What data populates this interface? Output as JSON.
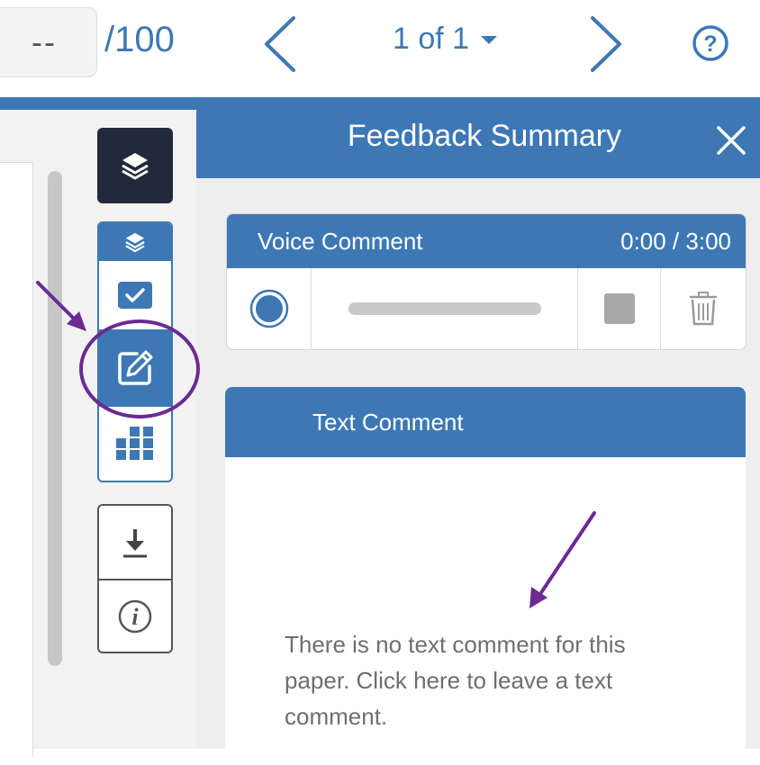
{
  "topbar": {
    "score_value": "--",
    "score_max": "/100",
    "page_indicator": "1 of 1",
    "icons": {
      "prev": "chevron-left-icon",
      "next": "chevron-right-icon",
      "dropdown": "caret-down-icon",
      "help": "question-circle-icon"
    }
  },
  "tool_rail": {
    "items": [
      "layers-icon",
      "layers-small-icon",
      "checkbox-icon",
      "edit-comment-icon",
      "grid-icon",
      "download-icon",
      "info-icon"
    ],
    "active_item": "edit-comment-icon"
  },
  "feedback_panel": {
    "title": "Feedback Summary",
    "voice_comment": {
      "title": "Voice Comment",
      "time": "0:00 / 3:00",
      "progress": 0
    },
    "text_comment": {
      "title": "Text Comment",
      "empty_message": "There is no text comment for this paper. Click here to leave a text comment."
    }
  },
  "colors": {
    "accent": "#3d78b5",
    "dark_button": "#22293a",
    "annotation": "#6b2a91"
  }
}
